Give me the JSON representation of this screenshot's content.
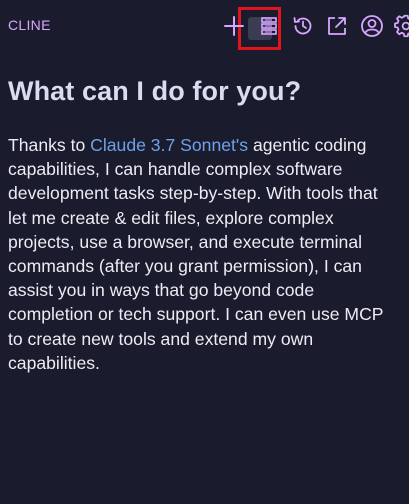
{
  "header": {
    "title": "CLINE",
    "icons": [
      "plus-icon",
      "server-icon",
      "history-icon",
      "popout-icon",
      "account-icon",
      "settings-icon"
    ]
  },
  "main": {
    "heading": "What can I do for you?",
    "intro_before": "Thanks to ",
    "link_text": "Claude 3.7 Sonnet's",
    "intro_after": " agentic coding capabilities, I can handle complex software development tasks step-by-step. With tools that let me create & edit files, explore complex projects, use a browser, and execute terminal commands (after you grant permission), I can assist you in ways that go beyond code completion or tech support. I can even use MCP to create new tools and extend my own capabilities."
  },
  "colors": {
    "background": "#1b1b2e",
    "accent": "#d8a6ff",
    "link": "#6ea2e8",
    "highlight": "#e0141c"
  }
}
